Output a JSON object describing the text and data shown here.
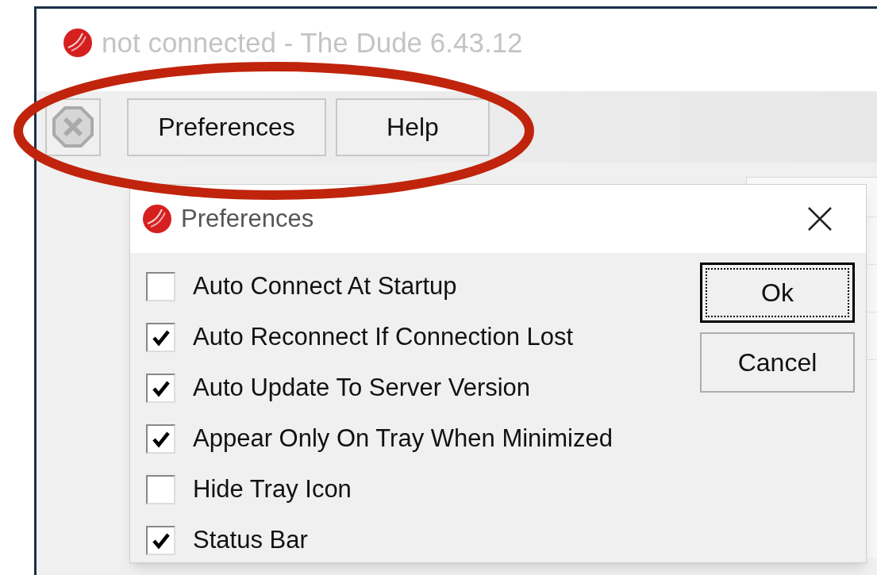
{
  "window": {
    "title": "not connected - The Dude 6.43.12"
  },
  "toolbar": {
    "buttons": [
      {
        "kind": "icon"
      },
      {
        "kind": "text",
        "label": "Preferences"
      },
      {
        "kind": "text",
        "label": "Help"
      }
    ]
  },
  "dialog": {
    "title": "Preferences",
    "options": [
      {
        "label": "Auto Connect At Startup",
        "checked": false
      },
      {
        "label": "Auto Reconnect If Connection Lost",
        "checked": true
      },
      {
        "label": "Auto Update To Server Version",
        "checked": true
      },
      {
        "label": "Appear Only On Tray When Minimized",
        "checked": true
      },
      {
        "label": "Hide Tray Icon",
        "checked": false
      },
      {
        "label": "Status Bar",
        "checked": true
      }
    ],
    "buttons": [
      {
        "label": "Ok",
        "focused": true
      },
      {
        "label": "Cancel",
        "focused": false
      }
    ]
  }
}
